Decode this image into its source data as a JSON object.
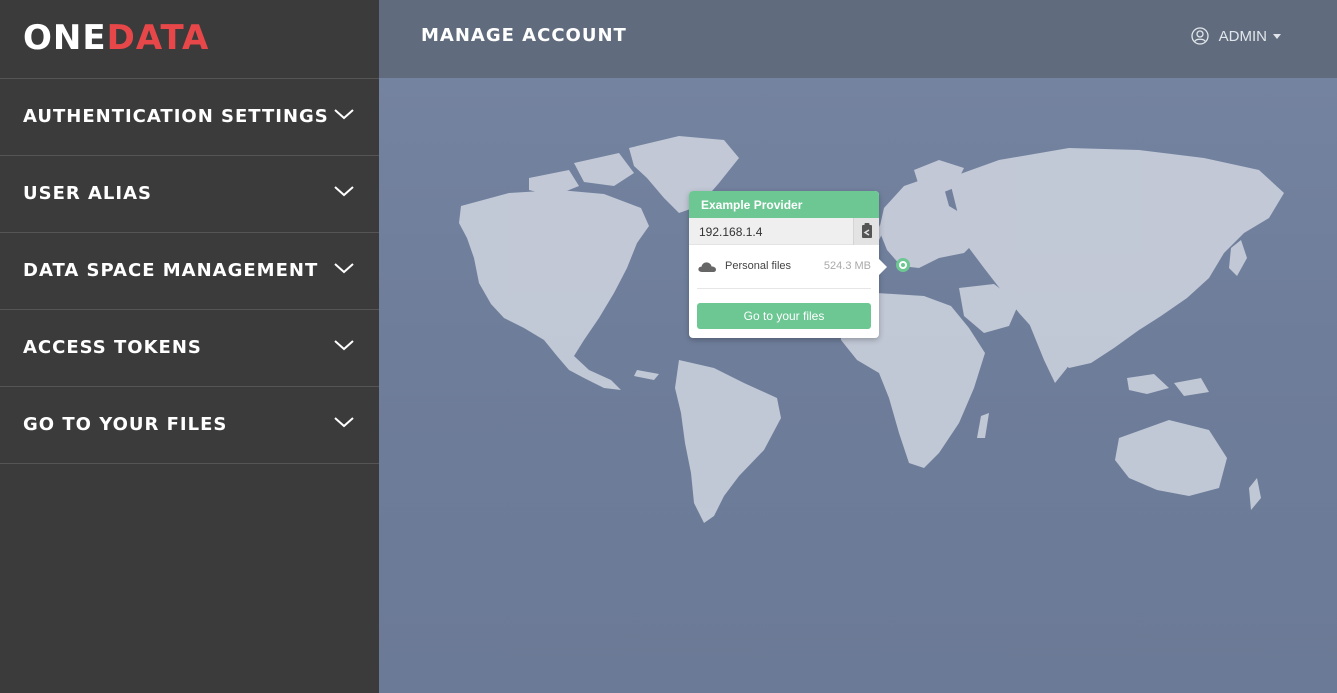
{
  "logo": {
    "part1": "ONE",
    "part2": "DATA"
  },
  "sidebar": {
    "items": [
      {
        "label": "AUTHENTICATION SETTINGS"
      },
      {
        "label": "USER ALIAS"
      },
      {
        "label": "DATA SPACE MANAGEMENT"
      },
      {
        "label": "ACCESS TOKENS"
      },
      {
        "label": "GO TO YOUR FILES"
      }
    ]
  },
  "header": {
    "title": "MANAGE ACCOUNT",
    "user": "ADMIN"
  },
  "popup": {
    "provider_name": "Example Provider",
    "ip": "192.168.1.4",
    "files_label": "Personal files",
    "files_size": "524.3 MB",
    "go_button": "Go to your files"
  },
  "icons": {
    "user": "user-circle-icon",
    "chevron": "chevron-down-icon",
    "copy": "clipboard-copy-icon",
    "cloud": "cloud-icon"
  },
  "colors": {
    "sidebar_bg": "#3b3b3b",
    "header_bg": "#606c7d",
    "accent_green": "#6cc793",
    "logo_red": "#e8474a",
    "map_land": "#c9cfdb"
  }
}
